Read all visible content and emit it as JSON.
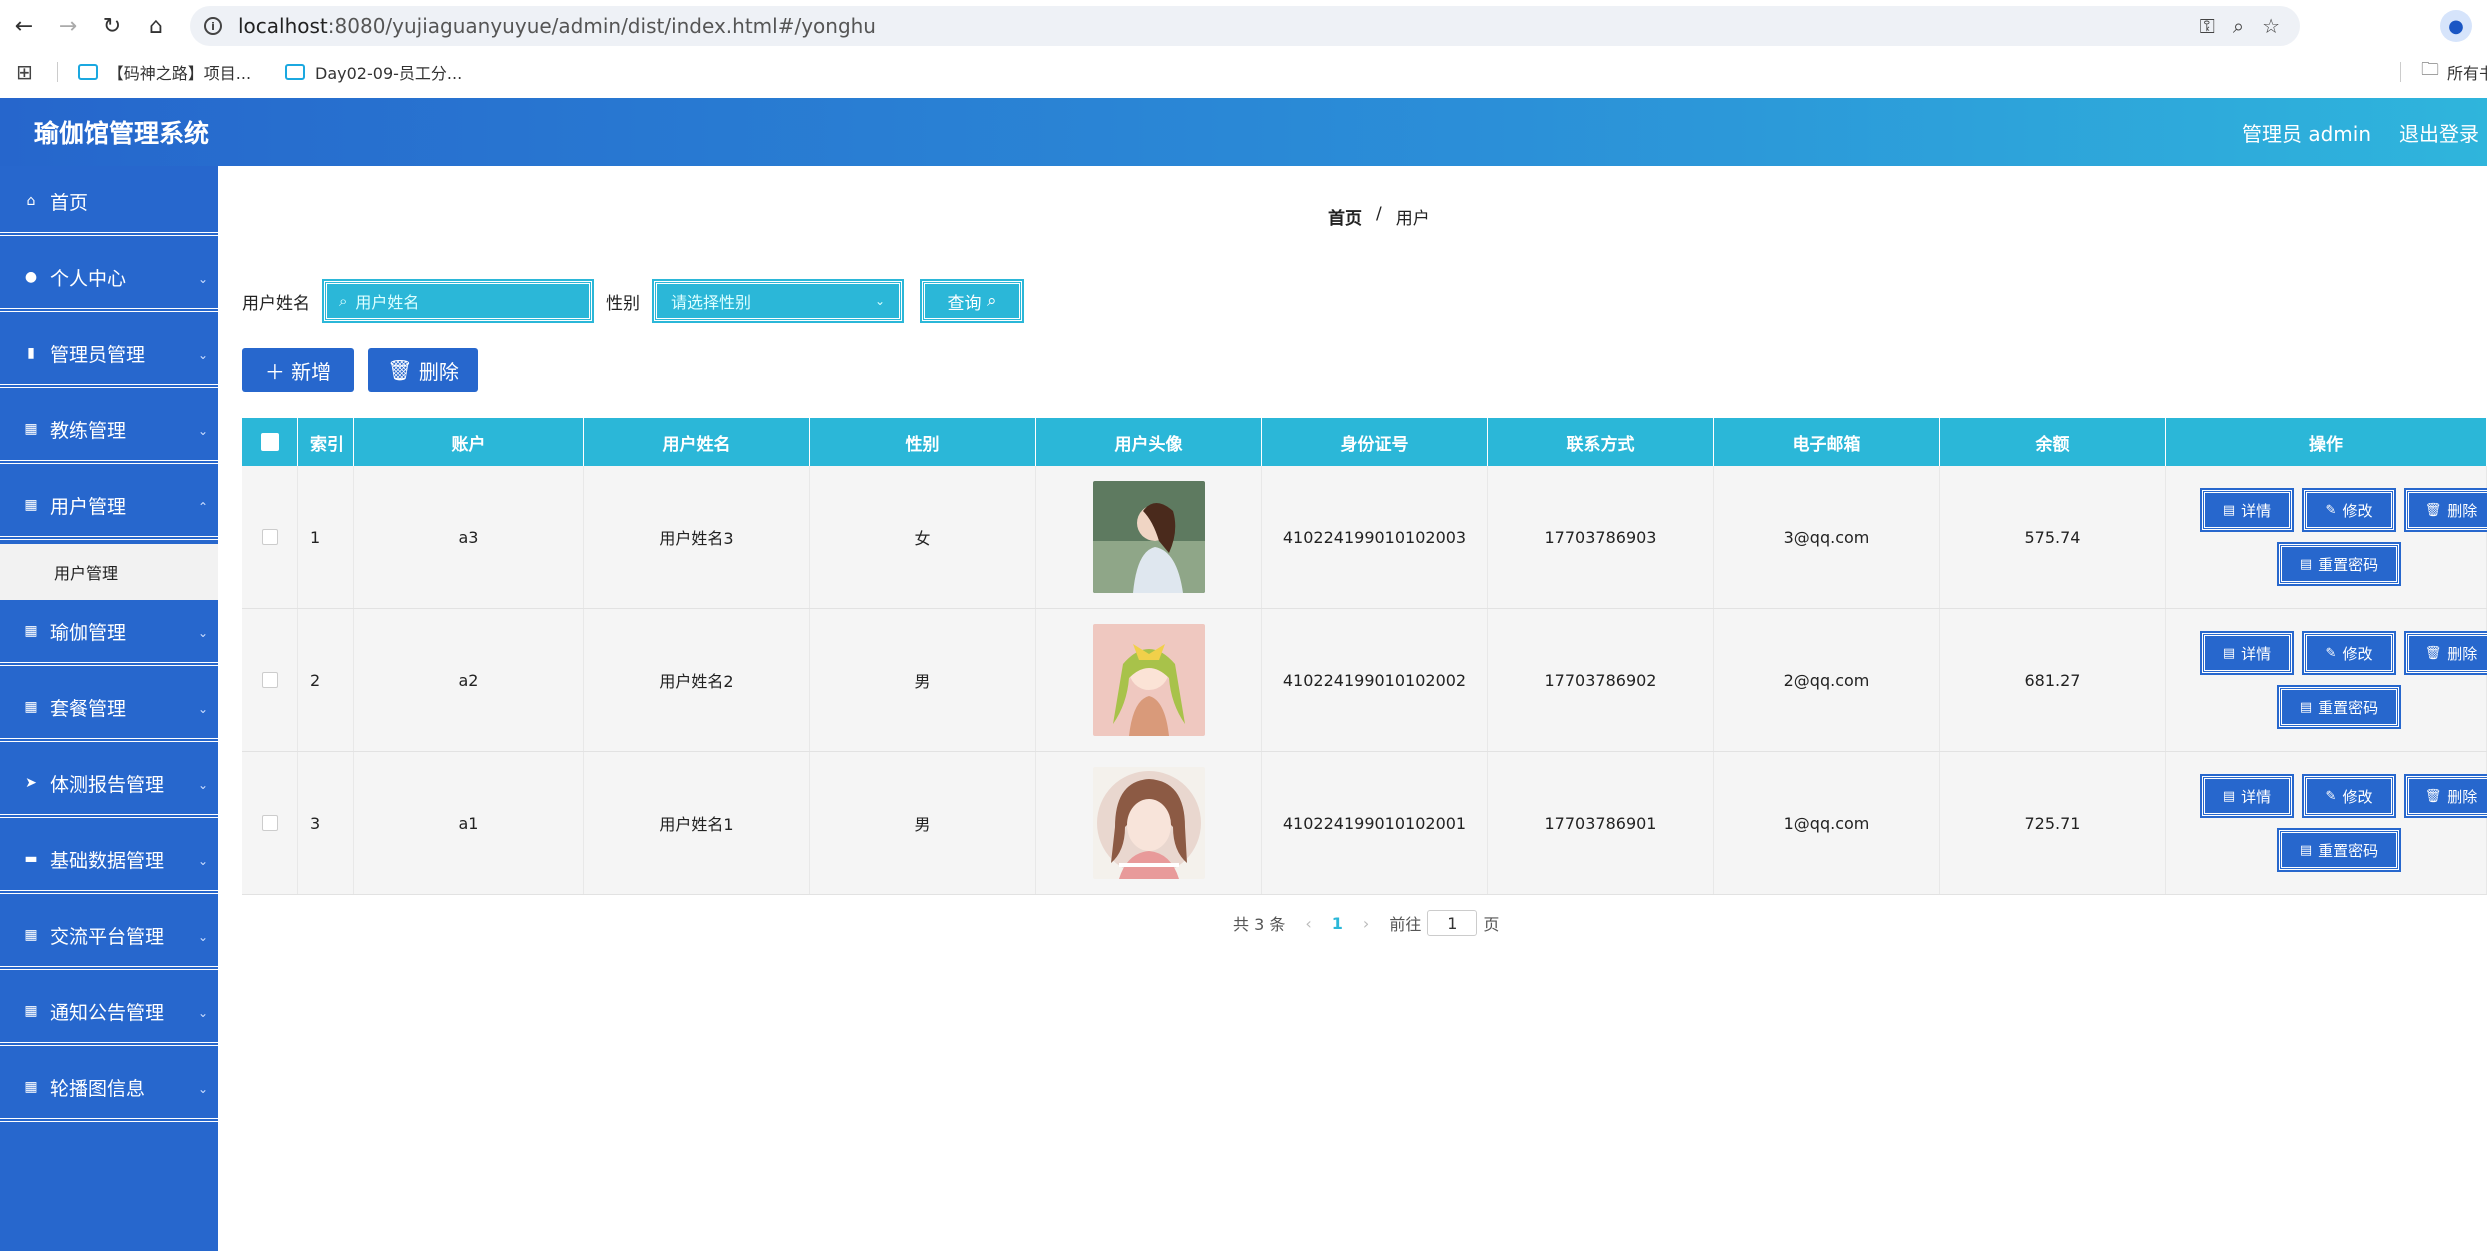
{
  "browser": {
    "url_host": "localhost",
    "url_rest": ":8080/yujiaguanyuyue/admin/dist/index.html#/yonghu",
    "bookmarks": [
      "【码神之路】项目...",
      "Day02-09-员工分..."
    ],
    "bookmarks_right": "所有书"
  },
  "header": {
    "title": "瑜伽馆管理系统",
    "user": "管理员 admin",
    "logout": "退出登录"
  },
  "sidebar": {
    "items": [
      {
        "label": "首页",
        "icon": "home-icon"
      },
      {
        "label": "个人中心",
        "icon": "person-icon"
      },
      {
        "label": "管理员管理",
        "icon": "chart-icon"
      },
      {
        "label": "教练管理",
        "icon": "grid-icon"
      },
      {
        "label": "用户管理",
        "icon": "grid-icon"
      },
      {
        "label": "瑜伽管理",
        "icon": "grid-icon"
      },
      {
        "label": "套餐管理",
        "icon": "grid-icon"
      },
      {
        "label": "体测报告管理",
        "icon": "send-icon"
      },
      {
        "label": "基础数据管理",
        "icon": "chat-icon"
      },
      {
        "label": "交流平台管理",
        "icon": "grid-icon"
      },
      {
        "label": "通知公告管理",
        "icon": "grid-icon"
      },
      {
        "label": "轮播图信息",
        "icon": "grid-icon"
      }
    ],
    "submenu": "用户管理"
  },
  "breadcrumb": {
    "home": "首页",
    "sep": "/",
    "current": "用户"
  },
  "search": {
    "name_label": "用户姓名",
    "name_placeholder": "用户姓名",
    "gender_label": "性别",
    "gender_placeholder": "请选择性别",
    "query_label": "查询"
  },
  "actions": {
    "add": "新增",
    "delete": "删除"
  },
  "table": {
    "headers": [
      "索引",
      "账户",
      "用户姓名",
      "性别",
      "用户头像",
      "身份证号",
      "联系方式",
      "电子邮箱",
      "余额",
      "操作"
    ],
    "rows": [
      {
        "index": "1",
        "account": "a3",
        "name": "用户姓名3",
        "gender": "女",
        "id_card": "410224199010102003",
        "phone": "17703786903",
        "email": "3@qq.com",
        "balance": "575.74"
      },
      {
        "index": "2",
        "account": "a2",
        "name": "用户姓名2",
        "gender": "男",
        "id_card": "410224199010102002",
        "phone": "17703786902",
        "email": "2@qq.com",
        "balance": "681.27"
      },
      {
        "index": "3",
        "account": "a1",
        "name": "用户姓名1",
        "gender": "男",
        "id_card": "410224199010102001",
        "phone": "17703786901",
        "email": "1@qq.com",
        "balance": "725.71"
      }
    ],
    "op_labels": {
      "detail": "详情",
      "edit": "修改",
      "delete": "删除",
      "reset": "重置密码"
    }
  },
  "pager": {
    "total": "共 3 条",
    "current": "1",
    "goto": "前往",
    "goto_value": "1",
    "page_unit": "页"
  }
}
